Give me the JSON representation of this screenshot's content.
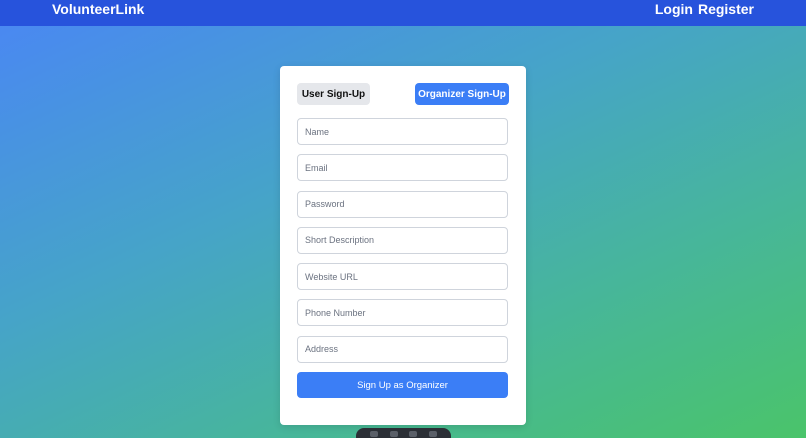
{
  "nav": {
    "brand": "VolunteerLink",
    "links": [
      {
        "label": "Login"
      },
      {
        "label": "Register"
      }
    ]
  },
  "signup": {
    "tabs": {
      "user": "User Sign-Up",
      "organizer": "Organizer Sign-Up"
    },
    "active_tab": "organizer",
    "fields": [
      {
        "name": "name",
        "placeholder": "Name",
        "value": ""
      },
      {
        "name": "email",
        "placeholder": "Email",
        "value": ""
      },
      {
        "name": "password",
        "placeholder": "Password",
        "value": ""
      },
      {
        "name": "short_description",
        "placeholder": "Short Description",
        "value": ""
      },
      {
        "name": "website_url",
        "placeholder": "Website URL",
        "value": ""
      },
      {
        "name": "phone_number",
        "placeholder": "Phone Number",
        "value": ""
      },
      {
        "name": "address",
        "placeholder": "Address",
        "value": ""
      }
    ],
    "submit_label": "Sign Up as Organizer"
  },
  "colors": {
    "navbar": "#2753dc",
    "accent": "#3b7ef6",
    "inactive_tab": "#e5e7eb"
  }
}
